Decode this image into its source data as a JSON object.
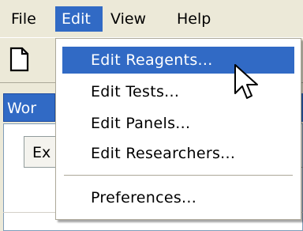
{
  "menubar": {
    "items": [
      {
        "label": "File",
        "active": false
      },
      {
        "label": "Edit",
        "active": true
      },
      {
        "label": "View",
        "active": false
      },
      {
        "label": "Help",
        "active": false
      }
    ]
  },
  "toolbar": {
    "new_icon": "new-document-icon"
  },
  "workspace": {
    "doc_tab_label": "Wor",
    "inner_tab_label": "Ex"
  },
  "edit_menu": {
    "items": [
      {
        "label": "Edit Reagents...",
        "highlighted": true
      },
      {
        "label": "Edit Tests...",
        "highlighted": false
      },
      {
        "label": "Edit Panels...",
        "highlighted": false
      },
      {
        "label": "Edit Researchers...",
        "highlighted": false
      },
      {
        "label": "Preferences...",
        "highlighted": false
      }
    ]
  },
  "colors": {
    "highlight": "#316ac5",
    "menu_background": "#ffffff",
    "chrome": "#ece9d8"
  },
  "cursor_icon": "arrow-pointer-icon"
}
